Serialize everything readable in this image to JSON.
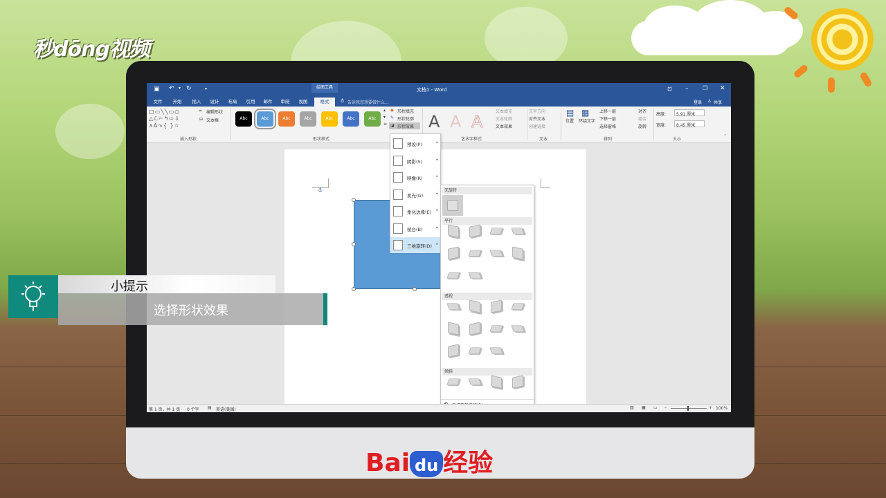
{
  "brand": {
    "logo": "秒dōng视频",
    "footer_left": "Bai",
    "footer_du": "du",
    "footer_right": "经验"
  },
  "word": {
    "title": "文档1 - Word",
    "context_tab": "绘图工具",
    "tell_me": "告诉我您想要做什么...",
    "signin": "登录",
    "share": "共享",
    "tabs": [
      "文件",
      "开始",
      "插入",
      "设计",
      "布局",
      "引用",
      "邮件",
      "审阅",
      "视图",
      "格式"
    ],
    "active_tab": "格式",
    "groups": {
      "insert_shapes": "插入形状",
      "shape_styles": "形状样式",
      "wordart": "艺术字样式",
      "text": "文本",
      "arrange": "排列",
      "size": "大小"
    },
    "edit_shape": "编辑形状",
    "textbox": "文本框",
    "style_buttons": [
      {
        "label": "Abc",
        "color": "#000000"
      },
      {
        "label": "Abc",
        "color": "#5b9bd5"
      },
      {
        "label": "Abc",
        "color": "#ed7d31"
      },
      {
        "label": "Abc",
        "color": "#a5a5a5"
      },
      {
        "label": "Abc",
        "color": "#ffc000"
      },
      {
        "label": "Abc",
        "color": "#4472c4"
      },
      {
        "label": "Abc",
        "color": "#70ad47"
      }
    ],
    "shape_fill": "形状填充",
    "shape_outline": "形状轮廓",
    "shape_effects": "形状效果",
    "wordart_letter": "A",
    "text_fill": "文本填充",
    "text_outline": "文本轮廓",
    "text_effects": "文本效果",
    "text_direction": "文字方向",
    "align_text": "对齐文本",
    "create_link": "创建链接",
    "position": "位置",
    "wrap_text": "环绕文字",
    "bring_forward": "上移一层",
    "send_backward": "下移一层",
    "selection_pane": "选择窗格",
    "align": "对齐",
    "group": "组合",
    "rotate": "旋转",
    "height_label": "高度:",
    "height_value": "5.91 厘米",
    "width_label": "宽度:",
    "width_value": "8.45 厘米",
    "status": {
      "page": "第 1 页，共 1 页",
      "words": "0 个字",
      "lang": "英语(美国)",
      "zoom": "100%"
    }
  },
  "effects_menu": [
    {
      "label": "预设(P)"
    },
    {
      "label": "阴影(S)"
    },
    {
      "label": "映像(R)"
    },
    {
      "label": "发光(G)"
    },
    {
      "label": "柔化边缘(E)"
    },
    {
      "label": "棱台(B)"
    },
    {
      "label": "三维旋转(D)"
    }
  ],
  "rotation_gallery": {
    "no_rotation": "无旋转",
    "parallel": "平行",
    "perspective": "透视",
    "oblique": "倾斜",
    "options": "三维旋转选项(R)..."
  },
  "tip": {
    "heading": "小提示",
    "text": "选择形状效果"
  }
}
